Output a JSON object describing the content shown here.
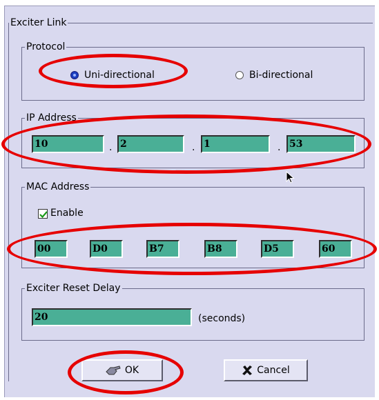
{
  "exciter_link": {
    "title": "Exciter Link",
    "protocol": {
      "title": "Protocol",
      "options": [
        {
          "label": "Uni-directional",
          "selected": true
        },
        {
          "label": "Bi-directional",
          "selected": false
        }
      ]
    },
    "ip_address": {
      "title": "IP Address",
      "octets": [
        "10",
        "2",
        "1",
        "53"
      ],
      "separator": "."
    },
    "mac_address": {
      "title": "MAC Address",
      "enable_label": "Enable",
      "enabled": true,
      "bytes": [
        "00",
        "D0",
        "B7",
        "B8",
        "D5",
        "60"
      ]
    },
    "reset_delay": {
      "title": "Exciter Reset Delay",
      "value": "20",
      "unit": "(seconds)"
    }
  },
  "buttons": {
    "ok_label": "OK",
    "cancel_label": "Cancel"
  },
  "colors": {
    "field": "#4aaf96",
    "dialog_bg": "#d9d9ef",
    "annotation": "#e60000",
    "radio_selected": "#1c3fbf"
  }
}
